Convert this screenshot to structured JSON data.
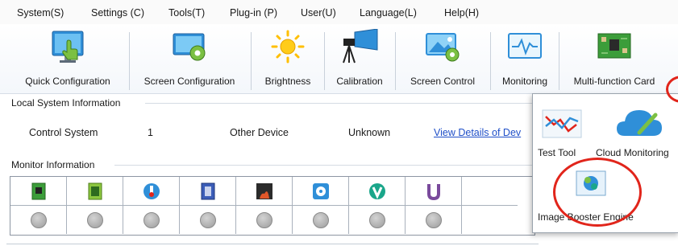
{
  "menu": [
    "System(S)",
    "Settings (C)",
    "Tools(T)",
    "Plug-in (P)",
    "User(U)",
    "Language(L)",
    "Help(H)"
  ],
  "toolbar": [
    {
      "label": "Quick Configuration",
      "icon": "monitor-touch-icon"
    },
    {
      "label": "Screen Configuration",
      "icon": "screen-gear-icon"
    },
    {
      "label": "Brightness",
      "icon": "sun-icon"
    },
    {
      "label": "Calibration",
      "icon": "camera-tripod-icon"
    },
    {
      "label": "Screen Control",
      "icon": "screen-image-gear-icon"
    },
    {
      "label": "Monitoring",
      "icon": "waveform-monitor-icon"
    },
    {
      "label": "Multi-function Card",
      "icon": "circuit-board-icon"
    }
  ],
  "local_system": {
    "title": "Local System Information",
    "control_system_label": "Control System",
    "control_system_value": "1",
    "other_device_label": "Other Device",
    "other_device_value": "Unknown",
    "details_link": "View Details of Dev"
  },
  "monitor": {
    "title": "Monitor Information",
    "icons": [
      "receiving-card-icon",
      "sending-card-icon",
      "thermometer-icon",
      "circuit-module-icon",
      "smoke-icon",
      "fan-icon",
      "voltage-icon",
      "cable-icon"
    ]
  },
  "popup": {
    "items": [
      {
        "label": "Test Tool",
        "icon": "test-chart-icon"
      },
      {
        "label": "Cloud Monitoring",
        "icon": "cloud-pen-icon"
      },
      {
        "label": "Image Booster Engine",
        "icon": "image-booster-icon"
      }
    ]
  },
  "colors": {
    "highlight_ring": "#e1251b",
    "link": "#1f4fc8",
    "accent": "#2f8fd8"
  }
}
